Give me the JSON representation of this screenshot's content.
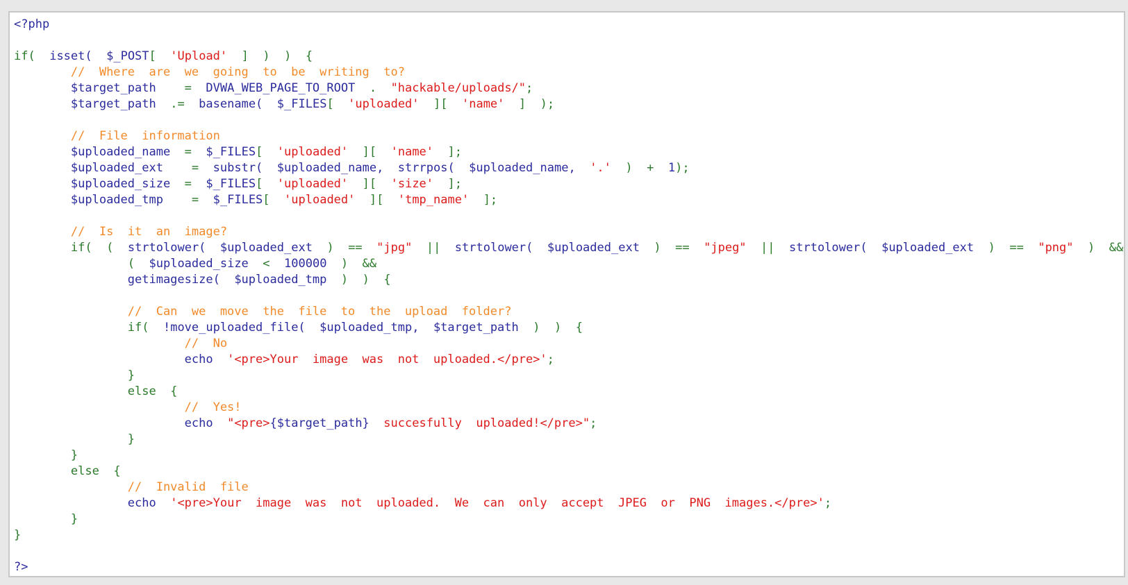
{
  "colors": {
    "keyword": "#2a7a2a",
    "function": "#2b2b9e",
    "string": "#dd1b1b",
    "comment": "#f28a2a",
    "background": "#ffffff",
    "frame": "#c8c8c8"
  },
  "code": {
    "lines": [
      [
        [
          "pl",
          "<?php"
        ]
      ],
      [],
      [
        [
          "kw",
          "if("
        ],
        [
          "pl",
          "  "
        ],
        [
          "fn",
          "isset("
        ],
        [
          "pl",
          "  "
        ],
        [
          "var",
          "$_POST"
        ],
        [
          "op",
          "[ "
        ],
        [
          "pl",
          " "
        ],
        [
          "str",
          "'Upload'"
        ],
        [
          "pl",
          "  "
        ],
        [
          "op",
          "]"
        ],
        [
          "pl",
          "  "
        ],
        [
          "op",
          ")"
        ],
        [
          "pl",
          "  "
        ],
        [
          "op",
          ")"
        ],
        [
          "pl",
          "  "
        ],
        [
          "op",
          "{"
        ]
      ],
      [
        [
          "pl",
          "        "
        ],
        [
          "com",
          "//  Where  are  we  going  to  be  writing  to?"
        ]
      ],
      [
        [
          "pl",
          "        "
        ],
        [
          "var",
          "$target_path"
        ],
        [
          "pl",
          "    "
        ],
        [
          "op",
          "="
        ],
        [
          "pl",
          "  "
        ],
        [
          "fn",
          "DVWA_WEB_PAGE_TO_ROOT"
        ],
        [
          "pl",
          "  "
        ],
        [
          "op",
          "."
        ],
        [
          "pl",
          "  "
        ],
        [
          "str",
          "\"hackable/uploads/\""
        ],
        [
          "op",
          ";"
        ]
      ],
      [
        [
          "pl",
          "        "
        ],
        [
          "var",
          "$target_path"
        ],
        [
          "pl",
          "  "
        ],
        [
          "op",
          ".="
        ],
        [
          "pl",
          "  "
        ],
        [
          "fn",
          "basename("
        ],
        [
          "pl",
          "  "
        ],
        [
          "var",
          "$_FILES"
        ],
        [
          "op",
          "["
        ],
        [
          "pl",
          "  "
        ],
        [
          "str",
          "'uploaded'"
        ],
        [
          "pl",
          "  "
        ],
        [
          "op",
          "]["
        ],
        [
          "pl",
          "  "
        ],
        [
          "str",
          "'name'"
        ],
        [
          "pl",
          "  "
        ],
        [
          "op",
          "]"
        ],
        [
          "pl",
          "  "
        ],
        [
          "op",
          ");"
        ]
      ],
      [],
      [
        [
          "pl",
          "        "
        ],
        [
          "com",
          "//  File  information"
        ]
      ],
      [
        [
          "pl",
          "        "
        ],
        [
          "var",
          "$uploaded_name"
        ],
        [
          "pl",
          "  "
        ],
        [
          "op",
          "="
        ],
        [
          "pl",
          "  "
        ],
        [
          "var",
          "$_FILES"
        ],
        [
          "op",
          "["
        ],
        [
          "pl",
          "  "
        ],
        [
          "str",
          "'uploaded'"
        ],
        [
          "pl",
          "  "
        ],
        [
          "op",
          "]["
        ],
        [
          "pl",
          "  "
        ],
        [
          "str",
          "'name'"
        ],
        [
          "pl",
          "  "
        ],
        [
          "op",
          "];"
        ]
      ],
      [
        [
          "pl",
          "        "
        ],
        [
          "var",
          "$uploaded_ext"
        ],
        [
          "pl",
          "    "
        ],
        [
          "op",
          "="
        ],
        [
          "pl",
          "  "
        ],
        [
          "fn",
          "substr("
        ],
        [
          "pl",
          "  "
        ],
        [
          "var",
          "$uploaded_name,"
        ],
        [
          "pl",
          "  "
        ],
        [
          "fn",
          "strrpos("
        ],
        [
          "pl",
          "  "
        ],
        [
          "var",
          "$uploaded_name,"
        ],
        [
          "pl",
          "  "
        ],
        [
          "str",
          "'.'"
        ],
        [
          "pl",
          "  "
        ],
        [
          "op",
          ")"
        ],
        [
          "pl",
          "  "
        ],
        [
          "op",
          "+"
        ],
        [
          "pl",
          "  "
        ],
        [
          "num",
          "1"
        ],
        [
          "op",
          ");"
        ]
      ],
      [
        [
          "pl",
          "        "
        ],
        [
          "var",
          "$uploaded_size"
        ],
        [
          "pl",
          "  "
        ],
        [
          "op",
          "="
        ],
        [
          "pl",
          "  "
        ],
        [
          "var",
          "$_FILES"
        ],
        [
          "op",
          "["
        ],
        [
          "pl",
          "  "
        ],
        [
          "str",
          "'uploaded'"
        ],
        [
          "pl",
          "  "
        ],
        [
          "op",
          "]["
        ],
        [
          "pl",
          "  "
        ],
        [
          "str",
          "'size'"
        ],
        [
          "pl",
          "  "
        ],
        [
          "op",
          "];"
        ]
      ],
      [
        [
          "pl",
          "        "
        ],
        [
          "var",
          "$uploaded_tmp"
        ],
        [
          "pl",
          "    "
        ],
        [
          "op",
          "="
        ],
        [
          "pl",
          "  "
        ],
        [
          "var",
          "$_FILES"
        ],
        [
          "op",
          "["
        ],
        [
          "pl",
          "  "
        ],
        [
          "str",
          "'uploaded'"
        ],
        [
          "pl",
          "  "
        ],
        [
          "op",
          "]["
        ],
        [
          "pl",
          "  "
        ],
        [
          "str",
          "'tmp_name'"
        ],
        [
          "pl",
          "  "
        ],
        [
          "op",
          "];"
        ]
      ],
      [],
      [
        [
          "pl",
          "        "
        ],
        [
          "com",
          "//  Is  it  an  image?"
        ]
      ],
      [
        [
          "pl",
          "        "
        ],
        [
          "kw",
          "if("
        ],
        [
          "pl",
          "  "
        ],
        [
          "op",
          "("
        ],
        [
          "pl",
          "  "
        ],
        [
          "fn",
          "strtolower("
        ],
        [
          "pl",
          "  "
        ],
        [
          "var",
          "$uploaded_ext"
        ],
        [
          "pl",
          "  "
        ],
        [
          "op",
          ")"
        ],
        [
          "pl",
          "  "
        ],
        [
          "op",
          "=="
        ],
        [
          "pl",
          "  "
        ],
        [
          "str",
          "\"jpg\""
        ],
        [
          "pl",
          "  "
        ],
        [
          "op",
          "||"
        ],
        [
          "pl",
          "  "
        ],
        [
          "fn",
          "strtolower("
        ],
        [
          "pl",
          "  "
        ],
        [
          "var",
          "$uploaded_ext"
        ],
        [
          "pl",
          "  "
        ],
        [
          "op",
          ")"
        ],
        [
          "pl",
          "  "
        ],
        [
          "op",
          "=="
        ],
        [
          "pl",
          "  "
        ],
        [
          "str",
          "\"jpeg\""
        ],
        [
          "pl",
          "  "
        ],
        [
          "op",
          "||"
        ],
        [
          "pl",
          "  "
        ],
        [
          "fn",
          "strtolower("
        ],
        [
          "pl",
          "  "
        ],
        [
          "var",
          "$uploaded_ext"
        ],
        [
          "pl",
          "  "
        ],
        [
          "op",
          ")"
        ],
        [
          "pl",
          "  "
        ],
        [
          "op",
          "=="
        ],
        [
          "pl",
          "  "
        ],
        [
          "str",
          "\"png\""
        ],
        [
          "pl",
          "  "
        ],
        [
          "op",
          ")"
        ],
        [
          "pl",
          "  "
        ],
        [
          "op",
          "&&"
        ]
      ],
      [
        [
          "pl",
          "                "
        ],
        [
          "op",
          "("
        ],
        [
          "pl",
          "  "
        ],
        [
          "var",
          "$uploaded_size"
        ],
        [
          "pl",
          "  "
        ],
        [
          "op",
          "<"
        ],
        [
          "pl",
          "  "
        ],
        [
          "num",
          "100000"
        ],
        [
          "pl",
          "  "
        ],
        [
          "op",
          ")"
        ],
        [
          "pl",
          "  "
        ],
        [
          "op",
          "&&"
        ]
      ],
      [
        [
          "pl",
          "                "
        ],
        [
          "fn",
          "getimagesize("
        ],
        [
          "pl",
          "  "
        ],
        [
          "var",
          "$uploaded_tmp"
        ],
        [
          "pl",
          "  "
        ],
        [
          "op",
          ")"
        ],
        [
          "pl",
          "  "
        ],
        [
          "op",
          ")"
        ],
        [
          "pl",
          "  "
        ],
        [
          "op",
          "{"
        ]
      ],
      [],
      [
        [
          "pl",
          "                "
        ],
        [
          "com",
          "//  Can  we  move  the  file  to  the  upload  folder?"
        ]
      ],
      [
        [
          "pl",
          "                "
        ],
        [
          "kw",
          "if("
        ],
        [
          "pl",
          "  "
        ],
        [
          "fn",
          "!move_uploaded_file("
        ],
        [
          "pl",
          "  "
        ],
        [
          "var",
          "$uploaded_tmp,"
        ],
        [
          "pl",
          "  "
        ],
        [
          "var",
          "$target_path"
        ],
        [
          "pl",
          "  "
        ],
        [
          "op",
          ")"
        ],
        [
          "pl",
          "  "
        ],
        [
          "op",
          ")"
        ],
        [
          "pl",
          "  "
        ],
        [
          "op",
          "{"
        ]
      ],
      [
        [
          "pl",
          "                        "
        ],
        [
          "com",
          "//  No"
        ]
      ],
      [
        [
          "pl",
          "                        "
        ],
        [
          "fn",
          "echo"
        ],
        [
          "pl",
          "  "
        ],
        [
          "str",
          "'<pre>Your  image  was  not  uploaded.</pre>'"
        ],
        [
          "op",
          ";"
        ]
      ],
      [
        [
          "pl",
          "                "
        ],
        [
          "op",
          "}"
        ]
      ],
      [
        [
          "pl",
          "                "
        ],
        [
          "kw",
          "else"
        ],
        [
          "pl",
          "  "
        ],
        [
          "op",
          "{"
        ]
      ],
      [
        [
          "pl",
          "                        "
        ],
        [
          "com",
          "//  Yes!"
        ]
      ],
      [
        [
          "pl",
          "                        "
        ],
        [
          "fn",
          "echo"
        ],
        [
          "pl",
          "  "
        ],
        [
          "str",
          "\"<pre>"
        ],
        [
          "var",
          "{$target_path}"
        ],
        [
          "pl",
          "  "
        ],
        [
          "str",
          "succesfully  uploaded!</pre>\""
        ],
        [
          "op",
          ";"
        ]
      ],
      [
        [
          "pl",
          "                "
        ],
        [
          "op",
          "}"
        ]
      ],
      [
        [
          "pl",
          "        "
        ],
        [
          "op",
          "}"
        ]
      ],
      [
        [
          "pl",
          "        "
        ],
        [
          "kw",
          "else"
        ],
        [
          "pl",
          "  "
        ],
        [
          "op",
          "{"
        ]
      ],
      [
        [
          "pl",
          "                "
        ],
        [
          "com",
          "//  Invalid  file"
        ]
      ],
      [
        [
          "pl",
          "                "
        ],
        [
          "fn",
          "echo"
        ],
        [
          "pl",
          "  "
        ],
        [
          "str",
          "'<pre>Your  image  was  not  uploaded.  We  can  only  accept  JPEG  or  PNG  images.</pre>'"
        ],
        [
          "op",
          ";"
        ]
      ],
      [
        [
          "pl",
          "        "
        ],
        [
          "op",
          "}"
        ]
      ],
      [
        [
          "op",
          "}"
        ]
      ],
      [],
      [
        [
          "pl",
          "?>"
        ]
      ]
    ]
  }
}
